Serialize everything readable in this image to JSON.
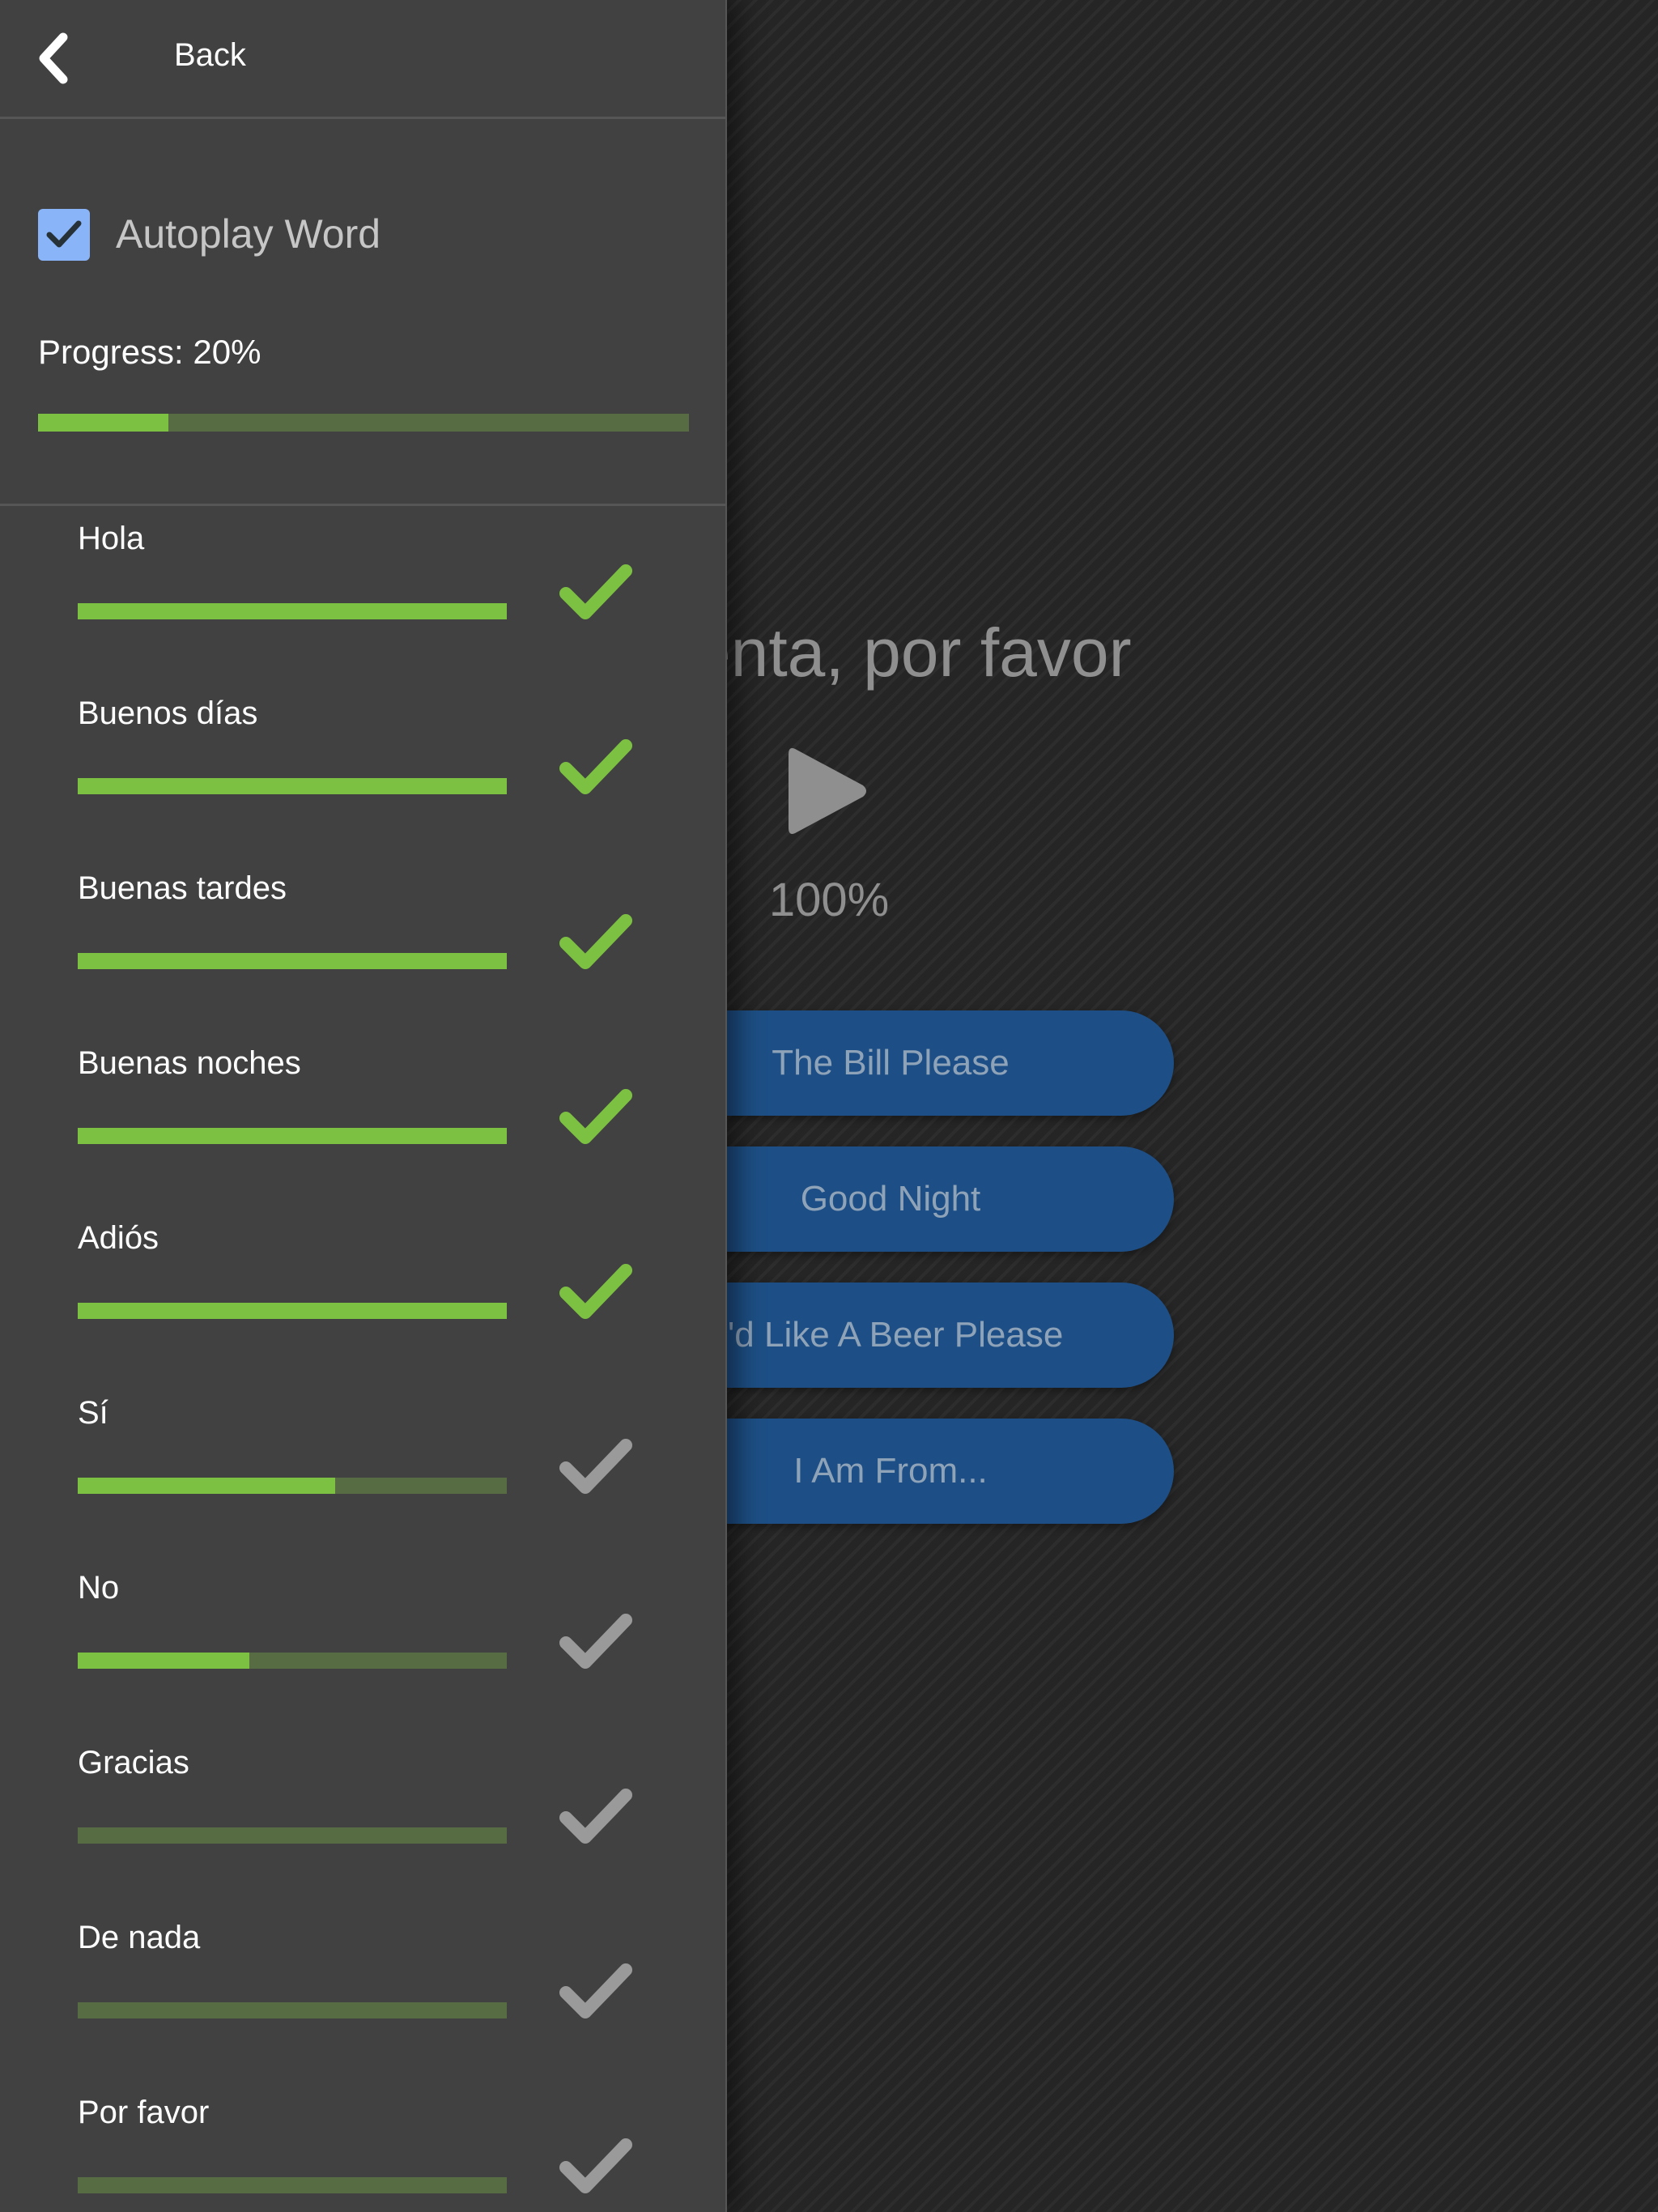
{
  "quiz": {
    "word": "La cuenta, por favor",
    "percent": "100%",
    "answers": [
      "The Bill Please",
      "Good Night",
      "I'd Like A Beer Please",
      "I Am From..."
    ]
  },
  "panel": {
    "back_label": "Back",
    "autoplay_label": "Autoplay Word",
    "autoplay_checked": true,
    "progress_label": "Progress: 20%",
    "progress_value": 0.2,
    "words": [
      {
        "label": "Hola",
        "progress": 1.0,
        "complete": true
      },
      {
        "label": "Buenos días",
        "progress": 1.0,
        "complete": true
      },
      {
        "label": "Buenas tardes",
        "progress": 1.0,
        "complete": true
      },
      {
        "label": "Buenas noches",
        "progress": 1.0,
        "complete": true
      },
      {
        "label": "Adiós",
        "progress": 1.0,
        "complete": true
      },
      {
        "label": "Sí",
        "progress": 0.6,
        "complete": false
      },
      {
        "label": "No",
        "progress": 0.4,
        "complete": false
      },
      {
        "label": "Gracias",
        "progress": 0.0,
        "complete": false
      },
      {
        "label": "De nada",
        "progress": 0.0,
        "complete": false
      },
      {
        "label": "Por favor",
        "progress": 0.0,
        "complete": false
      }
    ]
  },
  "colors": {
    "progress_fill": "#7cc142",
    "progress_track": "#586c43",
    "check_complete": "#7cc142",
    "check_incomplete": "#9a9a9a",
    "answer_button": "#1d4f86",
    "checkbox": "#8ab4f8"
  }
}
